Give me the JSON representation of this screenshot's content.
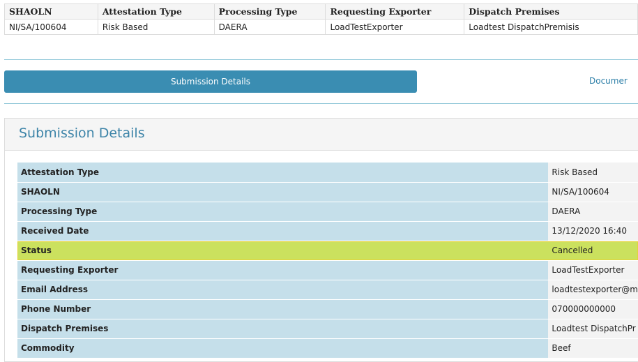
{
  "summary": {
    "headers": [
      "SHAOLN",
      "Attestation Type",
      "Processing Type",
      "Requesting Exporter",
      "Dispatch Premises"
    ],
    "row": [
      "NI/SA/100604",
      "Risk Based",
      "DAERA",
      "LoadTestExporter",
      "Loadtest DispatchPremisis"
    ]
  },
  "tabs": {
    "active_label": "Submission Details",
    "inactive_label": "Documer"
  },
  "panel": {
    "title": "Submission Details"
  },
  "details": [
    {
      "label": "Attestation Type",
      "value": "Risk Based"
    },
    {
      "label": "SHAOLN",
      "value": "NI/SA/100604"
    },
    {
      "label": "Processing Type",
      "value": "DAERA"
    },
    {
      "label": "Received Date",
      "value": "13/12/2020 16:40"
    },
    {
      "label": "Status",
      "value": "Cancelled"
    },
    {
      "label": "Requesting Exporter",
      "value": "LoadTestExporter"
    },
    {
      "label": "Email Address",
      "value": "loadtestexporter@m"
    },
    {
      "label": "Phone Number",
      "value": "070000000000"
    },
    {
      "label": "Dispatch Premises",
      "value": "Loadtest DispatchPr"
    },
    {
      "label": "Commodity",
      "value": "Beef"
    }
  ],
  "colors": {
    "tab_active": "#3a8db2",
    "label_cell": "#c5dfea",
    "value_cell": "#f3f3f3",
    "highlight": "#cbe15e",
    "highlight_border": "#e2d43a",
    "title_text": "#3d84a8"
  }
}
